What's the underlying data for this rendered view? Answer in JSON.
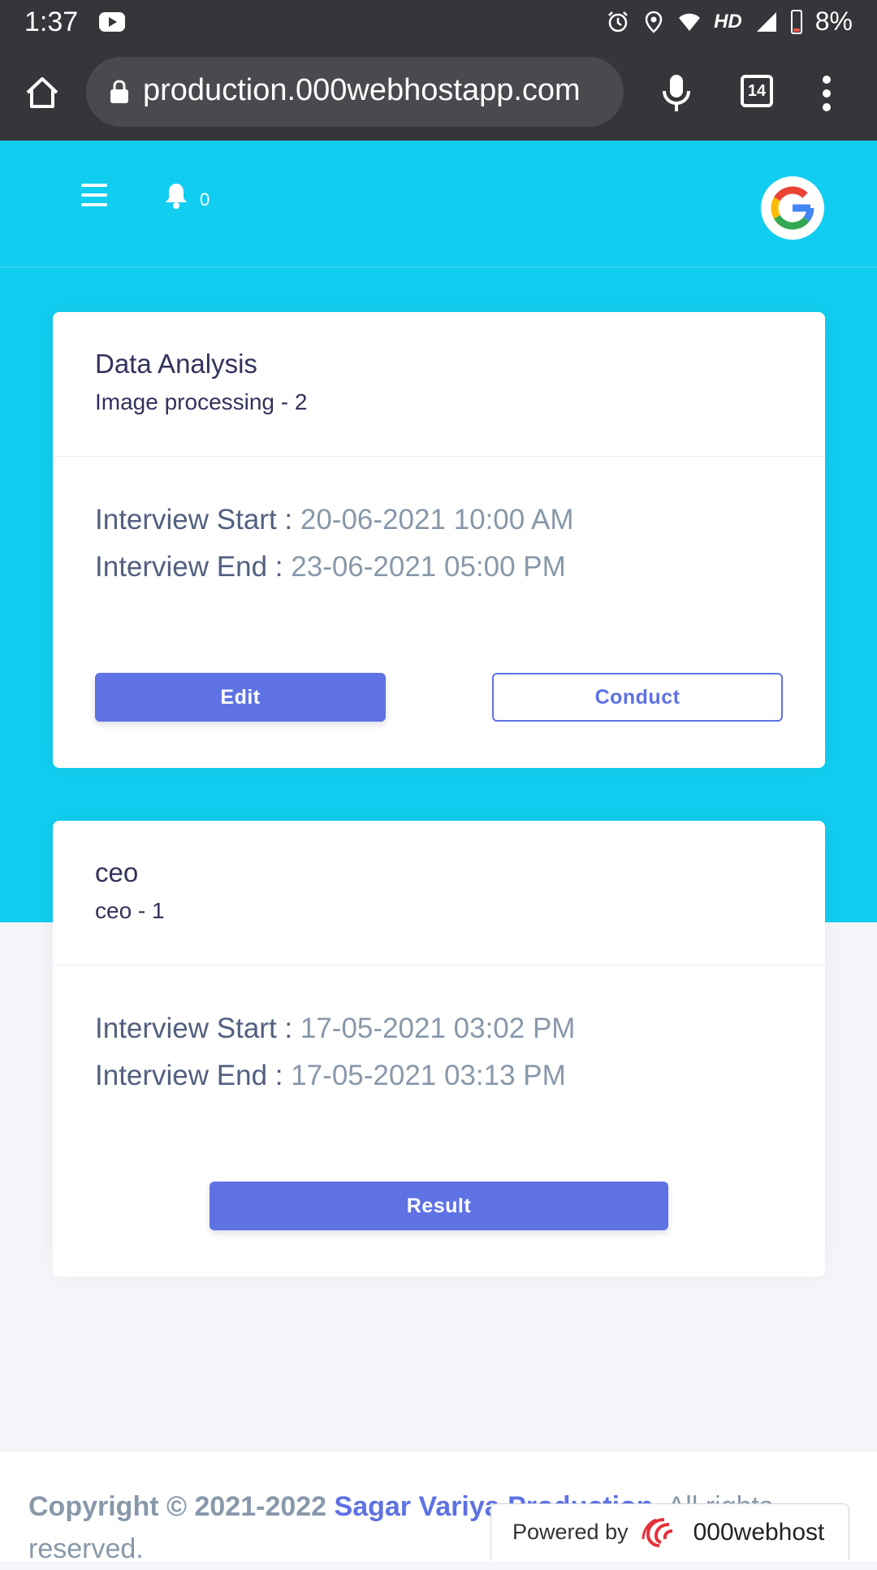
{
  "status_bar": {
    "time": "1:37",
    "network": "HD",
    "battery_percent": "8%",
    "icons": [
      "youtube-icon",
      "alarm-icon",
      "location-icon",
      "wifi-icon",
      "signal-icon",
      "battery-icon"
    ]
  },
  "browser": {
    "url": "production.000webhostapp.com",
    "tab_count": "14"
  },
  "nav": {
    "notification_count": "0"
  },
  "cards": [
    {
      "title": "Data Analysis",
      "subtitle": "Image processing - 2",
      "start_label": "Interview Start :",
      "start_value": "20-06-2021 10:00 AM",
      "end_label": "Interview End :",
      "end_value": "23-06-2021 05:00 PM",
      "edit_label": "Edit",
      "conduct_label": "Conduct"
    },
    {
      "title": "ceo",
      "subtitle": "ceo - 1",
      "start_label": "Interview Start :",
      "start_value": "17-05-2021 03:02 PM",
      "end_label": "Interview End :",
      "end_value": "17-05-2021 03:13 PM",
      "result_label": "Result"
    }
  ],
  "footer": {
    "copyright": "Copyright © 2021-2022",
    "company": "Sagar Variya Production.",
    "rights": "All rights reserved."
  },
  "powered_by": {
    "label": "Powered by",
    "name": "000webhost"
  },
  "colors": {
    "header": "#11cdef",
    "primary": "#5e72e4",
    "chrome": "#35363a"
  }
}
